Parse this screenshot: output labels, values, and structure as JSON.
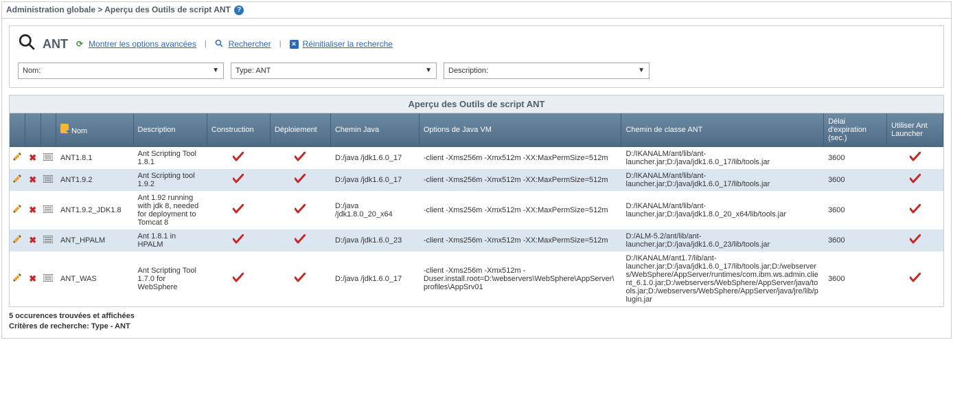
{
  "breadcrumb": {
    "root": "Administration globale",
    "sep": ">",
    "page": "Aperçu des Outils de script ANT"
  },
  "search": {
    "title": "ANT",
    "advanced": "Montrer les options avancées",
    "search": "Rechercher",
    "reset": "Réinitialiser la recherche",
    "filters": {
      "name_label": "Nom:",
      "type_label": "Type: ANT",
      "desc_label": "Description:"
    }
  },
  "results": {
    "title": "Aperçu des Outils de script ANT",
    "headers": {
      "nom": "Nom",
      "desc": "Description",
      "constr": "Construction",
      "deploy": "Déploiement",
      "java": "Chemin Java",
      "vm": "Options de Java VM",
      "cp": "Chemin de classe ANT",
      "delay": "Délai d'expiration (sec.)",
      "launch": "Utiliser Ant Launcher"
    },
    "rows": [
      {
        "nom": "ANT1.8.1",
        "desc": "Ant Scripting Tool 1.8.1",
        "constr": true,
        "deploy": true,
        "java": "D:/java /jdk1.6.0_17",
        "vm": "-client -Xms256m -Xmx512m -XX:MaxPermSize=512m",
        "cp": "D:/IKANALM/ant/lib/ant-launcher.jar;D:/java/jdk1.6.0_17/lib/tools.jar",
        "delay": "3600",
        "launch": true
      },
      {
        "nom": "ANT1.9.2",
        "desc": "Ant Scripting tool 1.9.2",
        "constr": true,
        "deploy": true,
        "java": "D:/java /jdk1.6.0_17",
        "vm": "-client -Xms256m -Xmx512m -XX:MaxPermSize=512m",
        "cp": "D:/IKANALM/ant/lib/ant-launcher.jar;D:/java/jdk1.6.0_17/lib/tools.jar",
        "delay": "3600",
        "launch": true
      },
      {
        "nom": "ANT1.9.2_JDK1.8",
        "desc": "Ant 1.92 running with jdk 8, needed for deployment to Tomcat 8",
        "constr": true,
        "deploy": true,
        "java": "D:/java /jdk1.8.0_20_x64",
        "vm": "-client -Xms256m -Xmx512m -XX:MaxPermSize=512m",
        "cp": "D:/IKANALM/ant/lib/ant-launcher.jar;D:/java/jdk1.8.0_20_x64/lib/tools.jar",
        "delay": "3600",
        "launch": true
      },
      {
        "nom": "ANT_HPALM",
        "desc": "Ant 1.8.1 in HPALM",
        "constr": true,
        "deploy": true,
        "java": "D:/java /jdk1.6.0_23",
        "vm": "-client -Xms256m -Xmx512m -XX:MaxPermSize=512m",
        "cp": "D:/ALM-5.2/ant/lib/ant-launcher.jar;D:/java/jdk1.6.0_23/lib/tools.jar",
        "delay": "3600",
        "launch": true
      },
      {
        "nom": "ANT_WAS",
        "desc": "Ant Scripting Tool 1.7.0 for WebSphere",
        "constr": true,
        "deploy": true,
        "java": "D:/java /jdk1.6.0_17",
        "vm": "-client -Xms256m -Xmx512m -Duser.install.root=D:\\webservers\\WebSphere\\AppServer\\profiles\\AppSrv01",
        "cp": "D:/IKANALM/ant1.7/lib/ant-launcher.jar;D:/java/jdk1.6.0_17/lib/tools.jar;D:/webservers/WebSphere/AppServer/runtimes/com.ibm.ws.admin.client_6.1.0.jar;D:/webservers/WebSphere/AppServer/java/tools.jar;D:/webservers/WebSphere/AppServer/java/jre/lib/plugin.jar",
        "delay": "3600",
        "launch": true
      }
    ]
  },
  "footer": {
    "count": "5 occurences trouvées et affichées",
    "criteria": "Critères de recherche: Type - ANT"
  }
}
